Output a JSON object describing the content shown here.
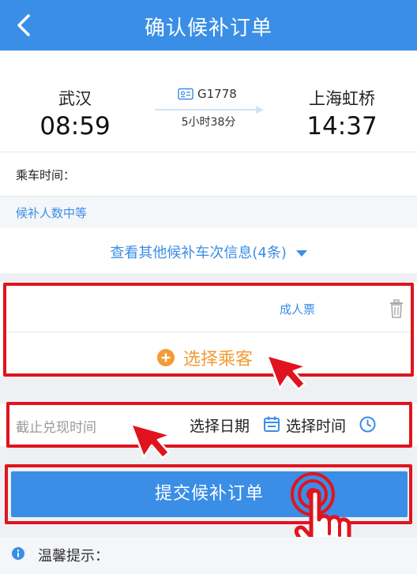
{
  "header": {
    "title": "确认候补订单"
  },
  "train": {
    "from_station": "武汉",
    "from_time": "08:59",
    "to_station": "上海虹桥",
    "to_time": "14:37",
    "train_no": "G1778",
    "duration": "5小时38分"
  },
  "ride_time_label": "乘车时间：",
  "waitlist_level": "候补人数中等",
  "other_trains_link": "查看其他候补车次信息(4条)",
  "passenger": {
    "ticket_type": "成人票",
    "select_passenger": "选择乘客"
  },
  "deadline": {
    "label": "截止兑现时间",
    "select_date": "选择日期",
    "select_time": "选择时间"
  },
  "submit_label": "提交候补订单",
  "tips_label": "温馨提示：",
  "colors": {
    "primary": "#3a8ee6",
    "highlight_red": "#e0141e",
    "accent_orange": "#f39b35"
  }
}
